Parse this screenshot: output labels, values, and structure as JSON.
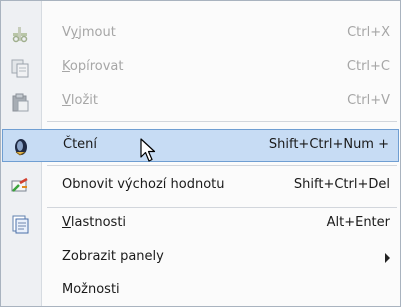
{
  "menu": {
    "items": [
      {
        "label": "Vyjmout",
        "shortcut": "Ctrl+X",
        "icon": "scissors-icon",
        "enabled": false
      },
      {
        "label": "Kopírovat",
        "shortcut": "Ctrl+C",
        "icon": "copy-icon",
        "enabled": false
      },
      {
        "label": "Vložit",
        "shortcut": "Ctrl+V",
        "icon": "paste-icon",
        "enabled": false
      },
      {
        "label": "Čtení",
        "shortcut": "Shift+Ctrl+Num +",
        "icon": "speaker-icon",
        "enabled": true,
        "highlighted": true
      },
      {
        "label": "Obnovit výchozí hodnotu",
        "shortcut": "Shift+Ctrl+Del",
        "icon": "reset-icon",
        "enabled": true
      },
      {
        "label": "Vlastnosti",
        "shortcut": "Alt+Enter",
        "icon": "properties-icon",
        "enabled": true
      },
      {
        "label": "Zobrazit panely",
        "icon": "",
        "enabled": true,
        "has_submenu": true
      },
      {
        "label": "Možnosti",
        "icon": "",
        "enabled": true
      }
    ]
  },
  "colors": {
    "highlight": "#c7dcf4",
    "highlight_border": "#6f9ed2",
    "disabled_text": "#a6a6a6"
  }
}
